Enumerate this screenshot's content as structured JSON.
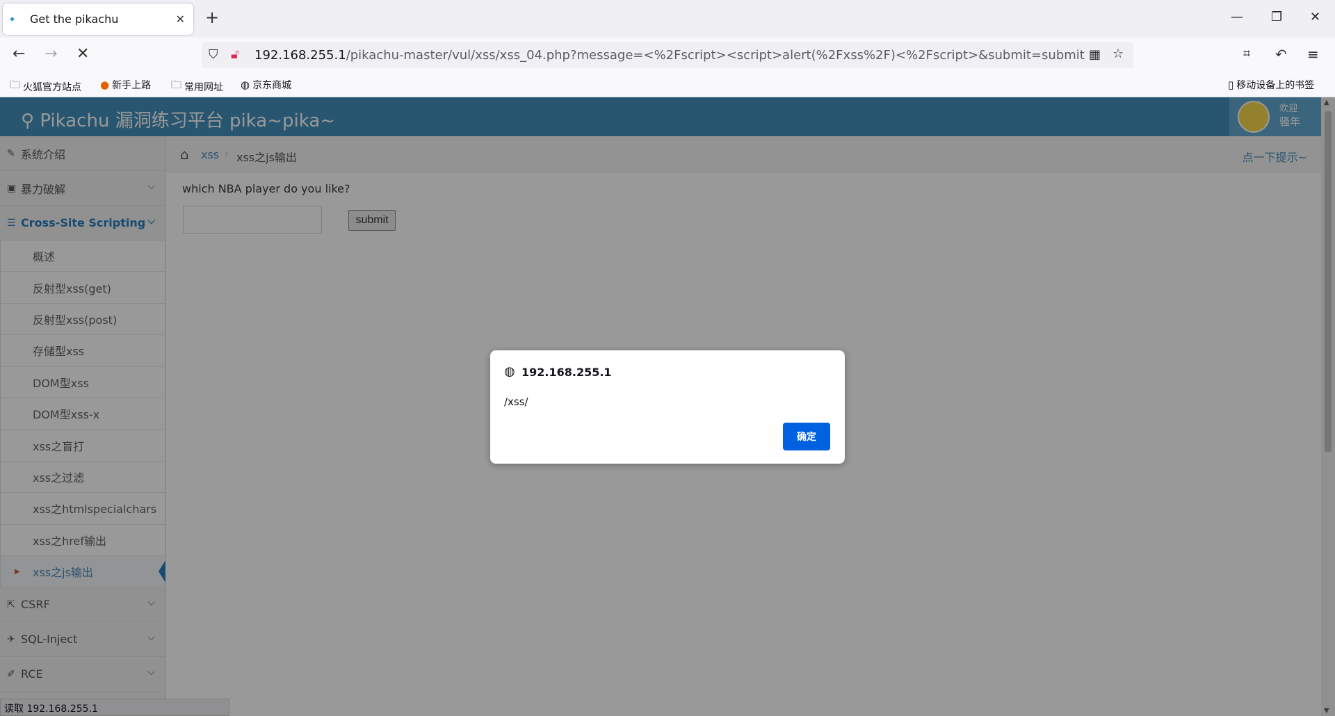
{
  "browser": {
    "tab_title": "Get the pikachu",
    "url_host": "192.168.255.1",
    "url_path": "/pikachu-master/vul/xss/xss_04.php?message=<%2Fscript><script>alert(%2Fxss%2F)<%2Fscript>&submit=submit",
    "bookmarks": [
      "火狐官方站点",
      "新手上路",
      "常用网址",
      "京东商城"
    ],
    "mobile_bookmarks": "移动设备上的书签",
    "status": "读取 192.168.255.1"
  },
  "header": {
    "brand": "Pikachu 漏洞练习平台 pika~pika~",
    "welcome_line1": "欢迎",
    "welcome_line2": "骚年"
  },
  "sidebar": {
    "items": [
      {
        "label": "系统介绍"
      },
      {
        "label": "暴力破解"
      },
      {
        "label": "Cross-Site Scripting"
      }
    ],
    "xss_sub": [
      "概述",
      "反射型xss(get)",
      "反射型xss(post)",
      "存储型xss",
      "DOM型xss",
      "DOM型xss-x",
      "xss之盲打",
      "xss之过滤",
      "xss之htmlspecialchars",
      "xss之href输出",
      "xss之js输出"
    ],
    "after": [
      {
        "label": "CSRF"
      },
      {
        "label": "SQL-Inject"
      },
      {
        "label": "RCE"
      }
    ]
  },
  "content": {
    "breadcrumb_link": "xss",
    "breadcrumb_current": "xss之js输出",
    "hint": "点一下提示~",
    "question": "which NBA player do you like?",
    "submit_label": "submit"
  },
  "dialog": {
    "title": "192.168.255.1",
    "message": "/xss/",
    "ok_label": "确定"
  },
  "colors": {
    "header": "#438eb9",
    "accent": "#2b7dbc",
    "dialog_button": "#0061e0"
  }
}
